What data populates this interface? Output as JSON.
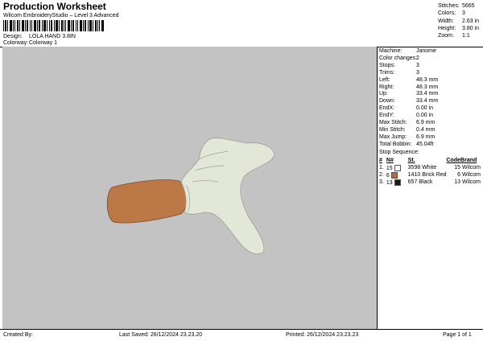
{
  "header": {
    "title": "Production Worksheet",
    "subtitle": "Wilcom EmbroideryStudio – Level 3 Advanced",
    "design_label": "Design:",
    "design_value": "LOLA HAND 3.8IN",
    "colorway_label": "Colorway:",
    "colorway_value": "Colorway 1"
  },
  "topstats": [
    {
      "label": "Stitches:",
      "value": "5665"
    },
    {
      "label": "Colors:",
      "value": "3"
    },
    {
      "label": "Width:",
      "value": "2.63 in"
    },
    {
      "label": "Height:",
      "value": "3.80 in"
    },
    {
      "label": "Zoom:",
      "value": "1:1"
    }
  ],
  "machine": [
    {
      "label": "Machine:",
      "value": "Janome"
    },
    {
      "label": "Color changes:",
      "value": "2"
    },
    {
      "label": "Stops:",
      "value": "3"
    },
    {
      "label": "Trims:",
      "value": "3"
    },
    {
      "label": "Left:",
      "value": "48.3 mm"
    },
    {
      "label": "Right:",
      "value": "48.3 mm"
    },
    {
      "label": "Up:",
      "value": "33.4 mm"
    },
    {
      "label": "Down:",
      "value": "33.4 mm"
    },
    {
      "label": "EndX:",
      "value": "0.00 in"
    },
    {
      "label": "EndY:",
      "value": "0.00 in"
    },
    {
      "label": "Max Stitch:",
      "value": "6.9 mm"
    },
    {
      "label": "Min Stitch:",
      "value": "0.4 mm"
    },
    {
      "label": "Max Jump:",
      "value": "6.9 mm"
    },
    {
      "label": "Total Bobbin:",
      "value": "45.04ft"
    }
  ],
  "stop_sequence": {
    "title": "Stop Sequence:",
    "headers": [
      "#",
      "N#",
      "St.",
      "Code",
      "Brand"
    ],
    "rows": [
      {
        "idx": "1.",
        "n": "15",
        "color": "#ffffff",
        "code": "3598",
        "name": "White",
        "st": "15",
        "brand": "Wilcom"
      },
      {
        "idx": "2.",
        "n": "6",
        "color": "#b86a3a",
        "code": "1410",
        "name": "Brick Red",
        "st": "6",
        "brand": "Wilcom"
      },
      {
        "idx": "3.",
        "n": "13",
        "color": "#1a1a1a",
        "code": "657",
        "name": "Black",
        "st": "13",
        "brand": "Wilcom"
      }
    ]
  },
  "footer": {
    "created": "Created By:",
    "saved": "Last Saved: 26/12/2024 23.23.20",
    "printed": "Printed: 26/12/2024 23.23.23",
    "page": "Page 1 of 1"
  },
  "colors": {
    "canvas": "#c3c3c3",
    "glove": "#e6eadb",
    "arm": "#bf7b47"
  }
}
